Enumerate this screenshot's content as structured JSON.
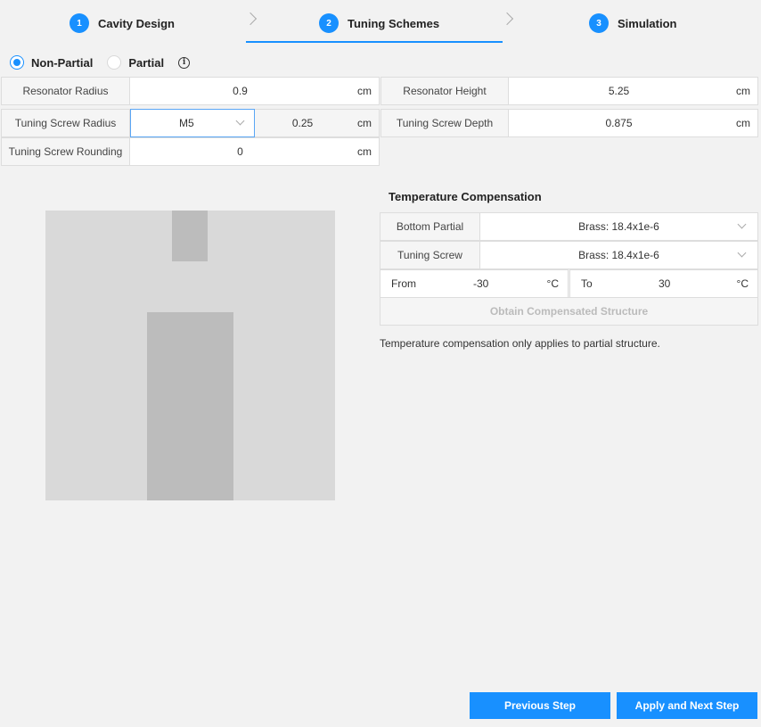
{
  "steps": [
    {
      "num": "1",
      "title": "Cavity Design"
    },
    {
      "num": "2",
      "title": "Tuning Schemes"
    },
    {
      "num": "3",
      "title": "Simulation"
    }
  ],
  "structure": {
    "options": [
      "Non-Partial",
      "Partial"
    ],
    "selected": "Non-Partial",
    "info_icon": "info-icon"
  },
  "fields": {
    "resonator_radius": {
      "label": "Resonator Radius",
      "value": "0.9",
      "unit": "cm"
    },
    "resonator_height": {
      "label": "Resonator Height",
      "value": "5.25",
      "unit": "cm"
    },
    "tuning_screw_radius": {
      "label": "Tuning Screw Radius",
      "select": "M5",
      "value": "0.25",
      "unit": "cm"
    },
    "tuning_screw_depth": {
      "label": "Tuning Screw Depth",
      "value": "0.875",
      "unit": "cm"
    },
    "tuning_screw_rounding": {
      "label": "Tuning Screw Rounding",
      "value": "0",
      "unit": "cm"
    }
  },
  "temperature": {
    "title": "Temperature Compensation",
    "bottom_partial": {
      "label": "Bottom Partial",
      "value": "Brass: 18.4x1e-6"
    },
    "tuning_screw": {
      "label": "Tuning Screw",
      "value": "Brass: 18.4x1e-6"
    },
    "from": {
      "label": "From",
      "value": "-30",
      "unit": "°C"
    },
    "to": {
      "label": "To",
      "value": "30",
      "unit": "°C"
    },
    "obtain_label": "Obtain Compensated Structure",
    "note": "Temperature compensation only applies to partial structure."
  },
  "buttons": {
    "previous": "Previous Step",
    "next": "Apply and Next Step"
  },
  "colors": {
    "accent": "#1890ff",
    "background": "#f2f2f2",
    "diagram_cavity": "#d9d9d9",
    "diagram_metal": "#bcbcbc"
  }
}
